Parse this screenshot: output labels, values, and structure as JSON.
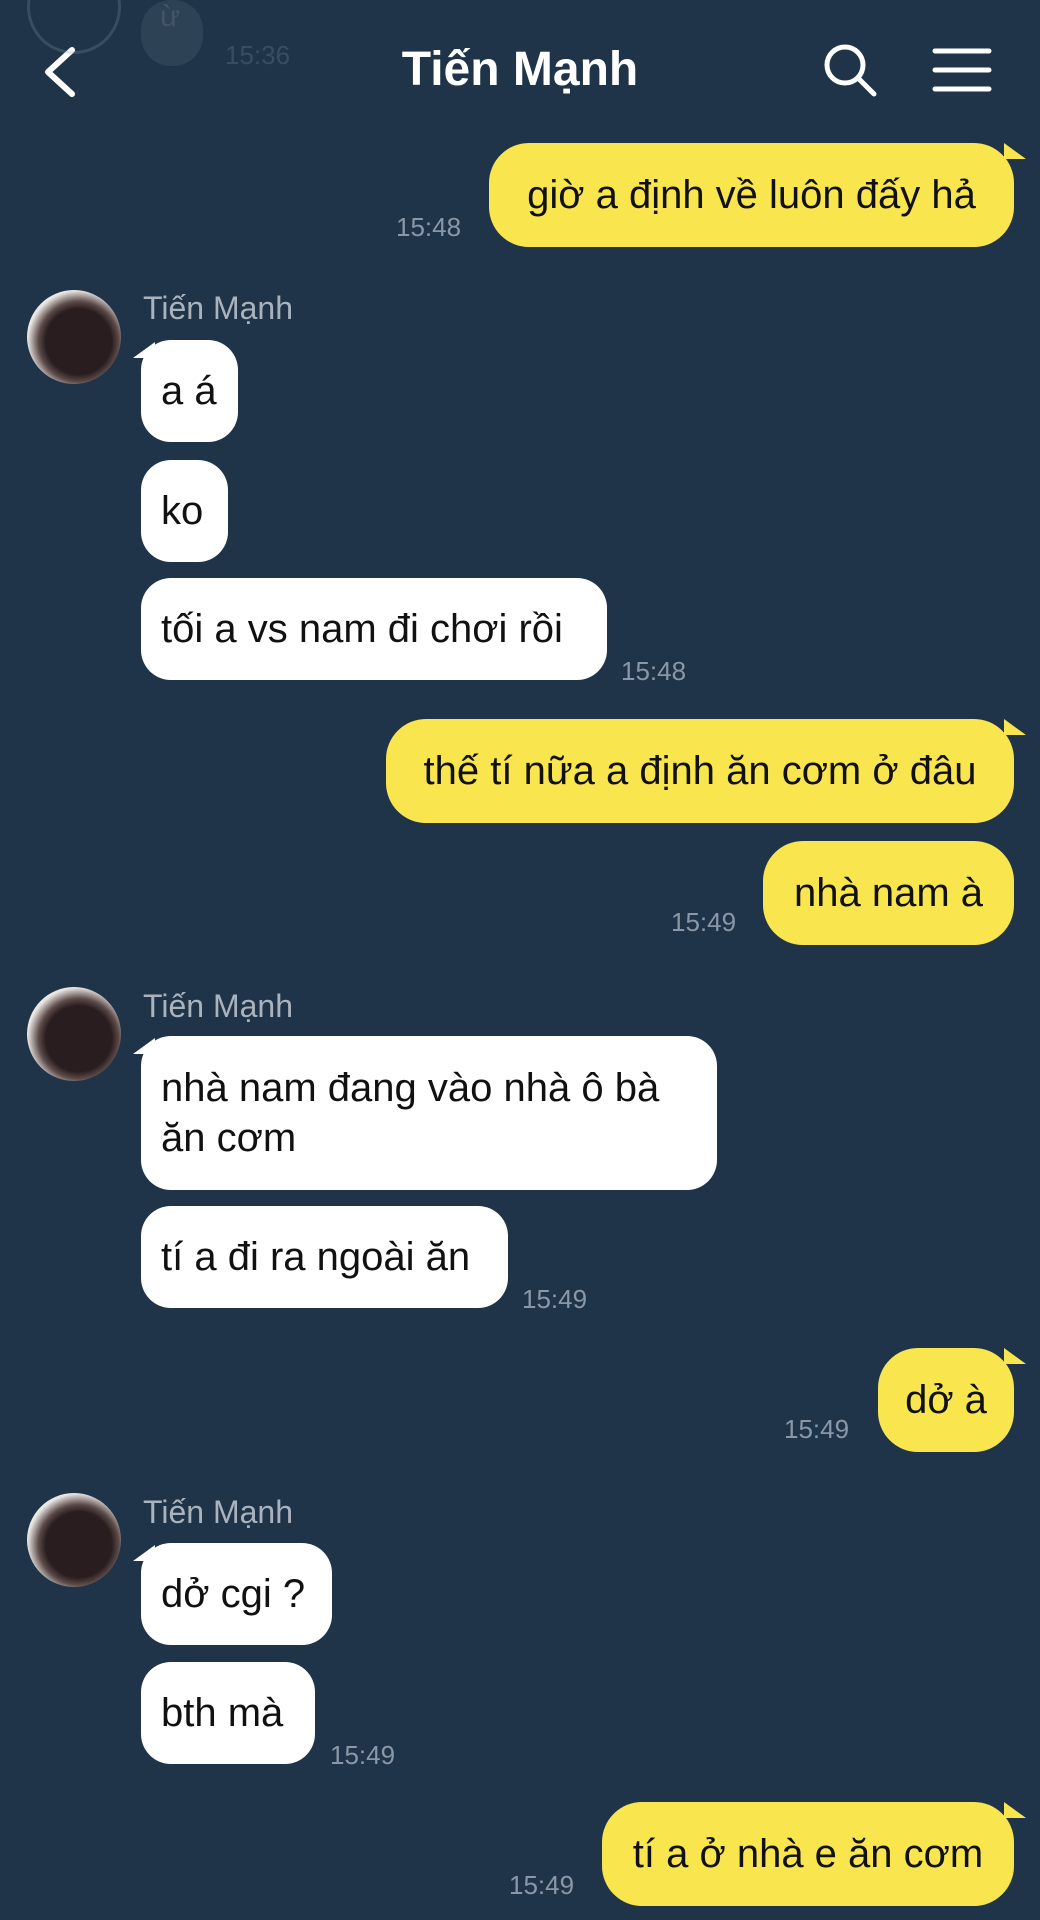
{
  "header": {
    "title": "Tiến Mạnh",
    "back_icon": "chevron-left-icon",
    "search_icon": "search-icon",
    "menu_icon": "hamburger-menu-icon"
  },
  "peek": {
    "text": "ừ",
    "time": "15:36"
  },
  "colors": {
    "background": "#1f3448",
    "outgoing": "#f9e64f",
    "incoming": "#ffffff",
    "timestamp": "#8a97a6"
  },
  "messages": {
    "m1": {
      "text": "giờ a định về luôn đấy hả",
      "time": "15:48"
    },
    "g1": {
      "sender": "Tiến Mạnh",
      "m1": "a á",
      "m2": "ko",
      "m3": "tối a vs nam đi chơi rồi",
      "time": "15:48"
    },
    "m2": {
      "text": "thế tí nữa a định ăn cơm ở đâu"
    },
    "m3": {
      "text": "nhà nam à",
      "time": "15:49"
    },
    "g2": {
      "sender": "Tiến Mạnh",
      "m1_line1": "nhà nam đang vào nhà ô bà",
      "m1_line2": "ăn cơm",
      "m2": "tí a đi ra ngoài ăn",
      "time": "15:49"
    },
    "m4": {
      "text": "dở à",
      "time": "15:49"
    },
    "g3": {
      "sender": "Tiến Mạnh",
      "m1": "dở cgi ?",
      "m2": "bth mà",
      "time": "15:49"
    },
    "m5": {
      "text": "tí a ở nhà e ăn cơm",
      "time": "15:49"
    }
  }
}
